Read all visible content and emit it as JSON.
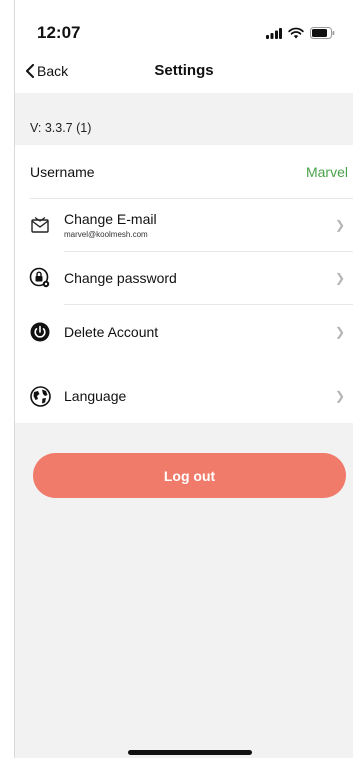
{
  "status_bar": {
    "time": "12:07"
  },
  "nav": {
    "back_label": "Back",
    "title": "Settings"
  },
  "version": "V: 3.3.7 (1)",
  "account": {
    "username_label": "Username",
    "username_value": "Marvel",
    "change_email_label": "Change E-mail",
    "email": "marvel@koolmesh.com",
    "change_password_label": "Change password",
    "delete_account_label": "Delete Account"
  },
  "language": {
    "label": "Language"
  },
  "logout": {
    "label": "Log out"
  },
  "colors": {
    "accent_green": "#4aa24a",
    "logout_button": "#f07b6a",
    "chevron": "#b5b5b5"
  },
  "icons": [
    "signal-icon",
    "wifi-icon",
    "battery-icon",
    "chevron-left-icon",
    "envelope-icon",
    "lock-gear-icon",
    "power-icon",
    "globe-icon",
    "chevron-right-icon"
  ]
}
